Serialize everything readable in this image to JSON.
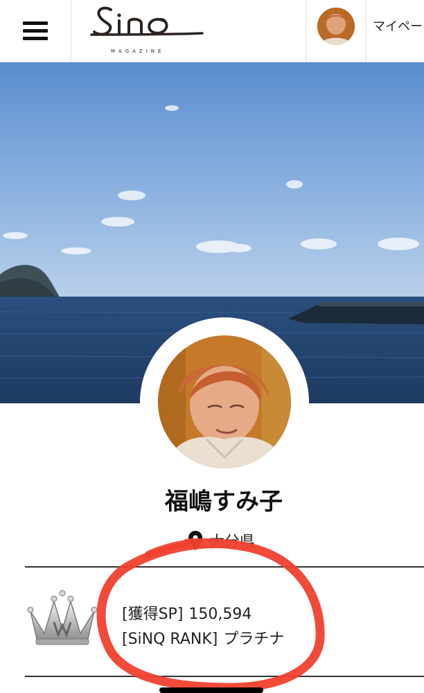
{
  "header": {
    "logo_text": "SinQ",
    "logo_subtitle": "MAGAZINE",
    "mypage_label": "マイペー"
  },
  "profile": {
    "name": "福嶋すみ子",
    "location": "大分県"
  },
  "stats": {
    "points_label": "[獲得SP]",
    "points_value": "150,594",
    "rank_label": "[SiNQ RANK]",
    "rank_value": "プラチナ"
  },
  "icons": {
    "menu": "hamburger-menu-icon",
    "location": "map-pin-icon",
    "rank": "crown-icon"
  },
  "colors": {
    "annotation": "#f0402e",
    "sky_top": "#5d8fcf",
    "sea": "#25476f"
  }
}
